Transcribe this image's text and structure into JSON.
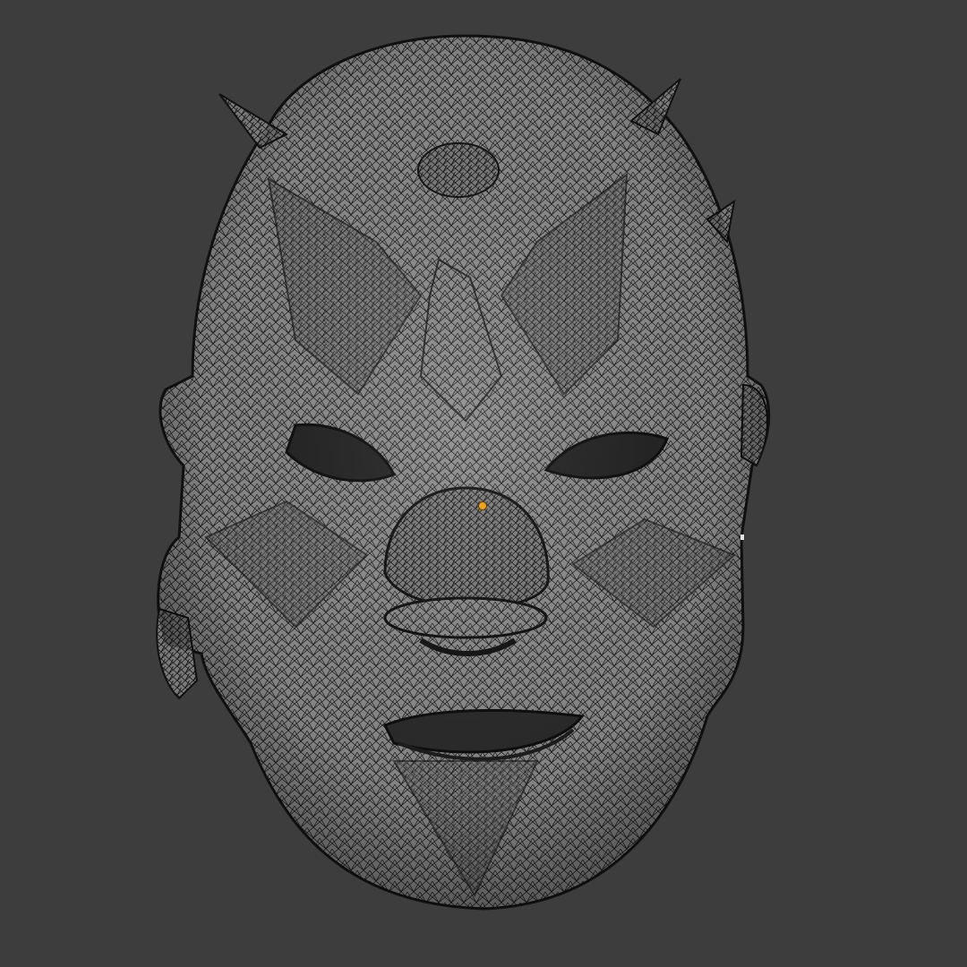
{
  "viewport": {
    "mode": "wireframe",
    "background_color": "#3d3d3d",
    "mesh_fill_color": "#8a8a8a",
    "wire_color": "#1a1a1a",
    "highlight_color": "#f0a21e"
  },
  "object": {
    "icon": "sculpted-clown-head-mesh-icon",
    "origin_icon": "object-origin-dot-icon"
  }
}
